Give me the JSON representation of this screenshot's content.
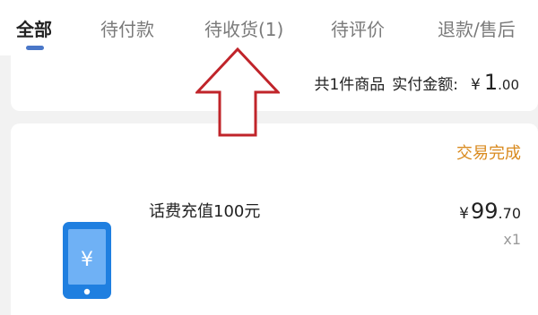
{
  "tabs": [
    {
      "label": "全部",
      "active": true
    },
    {
      "label": "待付款",
      "active": false
    },
    {
      "label": "待收货(1)",
      "active": false
    },
    {
      "label": "待评价",
      "active": false
    },
    {
      "label": "退款/售后",
      "active": false
    }
  ],
  "summary": {
    "items_text": "共1件商品",
    "paid_label": "实付金额:",
    "currency": "¥",
    "amount_int": "1",
    "amount_dec": ".00"
  },
  "order": {
    "status": "交易完成",
    "product_name": "话费充值100元",
    "price_currency": "¥",
    "price_int": "99",
    "price_dec": ".70",
    "quantity": "x1",
    "thumbnail_icon": "phone-recharge-icon"
  },
  "colors": {
    "accent_tab_indicator": "#4a77c8",
    "status_text": "#d98a1e",
    "annotation_arrow": "#c0242a",
    "product_icon_blue": "#1f7fe0"
  }
}
